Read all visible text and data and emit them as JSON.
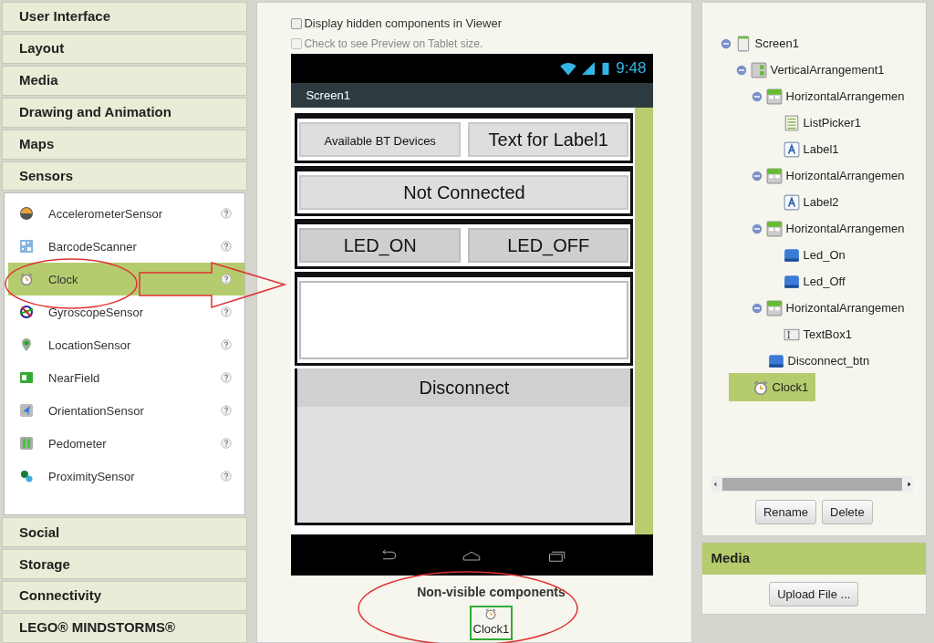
{
  "palette": {
    "categories": [
      {
        "label": "User Interface",
        "expanded": false
      },
      {
        "label": "Layout",
        "expanded": false
      },
      {
        "label": "Media",
        "expanded": false
      },
      {
        "label": "Drawing and Animation",
        "expanded": false
      },
      {
        "label": "Maps",
        "expanded": false
      },
      {
        "label": "Sensors",
        "expanded": true,
        "items": [
          {
            "label": "AccelerometerSensor",
            "kind": "accelerometer",
            "selected": false
          },
          {
            "label": "BarcodeScanner",
            "kind": "barcode",
            "selected": false
          },
          {
            "label": "Clock",
            "kind": "clock",
            "selected": true
          },
          {
            "label": "GyroscopeSensor",
            "kind": "gyroscope",
            "selected": false
          },
          {
            "label": "LocationSensor",
            "kind": "location",
            "selected": false
          },
          {
            "label": "NearField",
            "kind": "nearfield",
            "selected": false
          },
          {
            "label": "OrientationSensor",
            "kind": "orientation",
            "selected": false
          },
          {
            "label": "Pedometer",
            "kind": "pedometer",
            "selected": false
          },
          {
            "label": "ProximitySensor",
            "kind": "proximity",
            "selected": false
          }
        ]
      },
      {
        "label": "Social",
        "expanded": false
      },
      {
        "label": "Storage",
        "expanded": false
      },
      {
        "label": "Connectivity",
        "expanded": false
      },
      {
        "label": "LEGO® MINDSTORMS®",
        "expanded": false
      }
    ]
  },
  "viewer": {
    "options": [
      {
        "label": "Display hidden components in Viewer",
        "checked": false,
        "disabled": false
      },
      {
        "label": "Check to see Preview on Tablet size.",
        "checked": false,
        "disabled": true
      }
    ],
    "phone": {
      "time": "9:48",
      "title": "Screen1",
      "rows": [
        {
          "kind": "arrangement",
          "items": [
            {
              "kind": "listpicker",
              "text": "Available BT Devices"
            },
            {
              "kind": "label",
              "text": "Text for Label1"
            }
          ]
        },
        {
          "kind": "arrangement",
          "items": [
            {
              "kind": "label",
              "text": "Not Connected"
            }
          ]
        },
        {
          "kind": "arrangement",
          "items": [
            {
              "kind": "button",
              "text": "LED_ON"
            },
            {
              "kind": "button",
              "text": "LED_OFF"
            }
          ]
        },
        {
          "kind": "arrangement",
          "items": [
            {
              "kind": "textbox"
            }
          ]
        },
        {
          "kind": "button",
          "text": "Disconnect"
        }
      ]
    },
    "non_visible": {
      "title": "Non-visible components",
      "items": [
        {
          "label": "Clock1",
          "selected": true
        }
      ]
    }
  },
  "components": {
    "tree": [
      {
        "label": "Screen1",
        "kind": "screen",
        "expanded": true,
        "selected": false,
        "children": [
          {
            "label": "VerticalArrangement1",
            "kind": "vertical",
            "expanded": true,
            "selected": false,
            "children": [
              {
                "label": "HorizontalArrangemen",
                "kind": "horizontal",
                "expanded": true,
                "selected": false,
                "children": [
                  {
                    "label": "ListPicker1",
                    "kind": "listpicker",
                    "selected": false
                  },
                  {
                    "label": "Label1",
                    "kind": "label",
                    "selected": false
                  }
                ]
              },
              {
                "label": "HorizontalArrangemen",
                "kind": "horizontal",
                "expanded": true,
                "selected": false,
                "children": [
                  {
                    "label": "Label2",
                    "kind": "label",
                    "selected": false
                  }
                ]
              },
              {
                "label": "HorizontalArrangemen",
                "kind": "horizontal",
                "expanded": true,
                "selected": false,
                "children": [
                  {
                    "label": "Led_On",
                    "kind": "button",
                    "selected": false
                  },
                  {
                    "label": "Led_Off",
                    "kind": "button",
                    "selected": false
                  }
                ]
              },
              {
                "label": "HorizontalArrangemen",
                "kind": "horizontal",
                "expanded": true,
                "selected": false,
                "children": [
                  {
                    "label": "TextBox1",
                    "kind": "textbox",
                    "selected": false
                  }
                ]
              },
              {
                "label": "Disconnect_btn",
                "kind": "button",
                "selected": false
              }
            ]
          },
          {
            "label": "Clock1",
            "kind": "clock",
            "selected": true
          }
        ]
      }
    ],
    "buttons": [
      "Rename",
      "Delete"
    ]
  },
  "media": {
    "title": "Media",
    "button": "Upload File ..."
  }
}
